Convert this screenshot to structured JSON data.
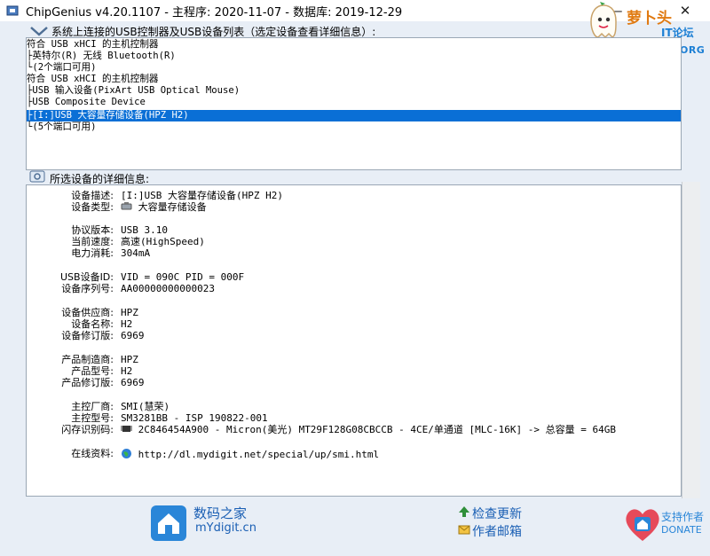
{
  "window": {
    "title": "ChipGenius v4.20.1107 - 主程序: 2020-11-07 - 数据库: 2019-12-29",
    "minimize": "—",
    "close": "✕"
  },
  "logo": {
    "name_cn": "萝卜头",
    "sub": "IT论坛",
    "url": "BBS.LUOBOTOU.ORG"
  },
  "device_list": {
    "label": "系统上连接的USB控制器及USB设备列表（选定设备查看详细信息）:",
    "items": [
      "符合 USB xHCI 的主机控制器",
      "├英特尔(R) 无线 Bluetooth(R)",
      "└(2个端口可用)",
      "符合 USB xHCI 的主机控制器",
      "├USB 输入设备(PixArt USB Optical Mouse)",
      "├USB Composite Device",
      "├[I:]USB 大容量存储设备(HPZ H2)",
      "└(5个端口可用)"
    ],
    "selected_index": 6
  },
  "details": {
    "label": "所选设备的详细信息:",
    "rows": [
      {
        "label": "设备描述:",
        "value": "[I:]USB 大容量存储设备(HPZ H2)"
      },
      {
        "label": "设备类型:",
        "value": "大容量存储设备"
      },
      {
        "label": "协议版本:",
        "value": "USB 3.10"
      },
      {
        "label": "当前速度:",
        "value": "高速(HighSpeed)"
      },
      {
        "label": "电力消耗:",
        "value": "304mA"
      },
      {
        "label": "USB设备ID:",
        "value": "VID = 090C PID = 000F"
      },
      {
        "label": "设备序列号:",
        "value": "AA00000000000023"
      },
      {
        "label": "设备供应商:",
        "value": "HPZ"
      },
      {
        "label": "设备名称:",
        "value": "H2"
      },
      {
        "label": "设备修订版:",
        "value": "6969"
      },
      {
        "label": "产品制造商:",
        "value": "HPZ"
      },
      {
        "label": "产品型号:",
        "value": "H2"
      },
      {
        "label": "产品修订版:",
        "value": "6969"
      },
      {
        "label": "主控厂商:",
        "value": "SMI(慧荣)"
      },
      {
        "label": "主控型号:",
        "value": "SM3281BB - ISP 190822-001"
      },
      {
        "label": "闪存识别码:",
        "value": "2C846454A900 - Micron(美光) MT29F128G08CBCCB - 4CE/单通道 [MLC-16K] -> 总容量 = 64GB"
      },
      {
        "label": "在线资料:",
        "value": "http://dl.mydigit.net/special/up/smi.html"
      }
    ]
  },
  "footer": {
    "site_cn": "数码之家",
    "site_url": "mYdigit.cn",
    "check_update": "检查更新",
    "author_email": "作者邮箱",
    "support_author": "支持作者",
    "donate": "DONATE"
  },
  "colors": {
    "selection": "#0a6fd6",
    "link_blue": "#1a5fb4",
    "logo_orange": "#e07a12"
  }
}
